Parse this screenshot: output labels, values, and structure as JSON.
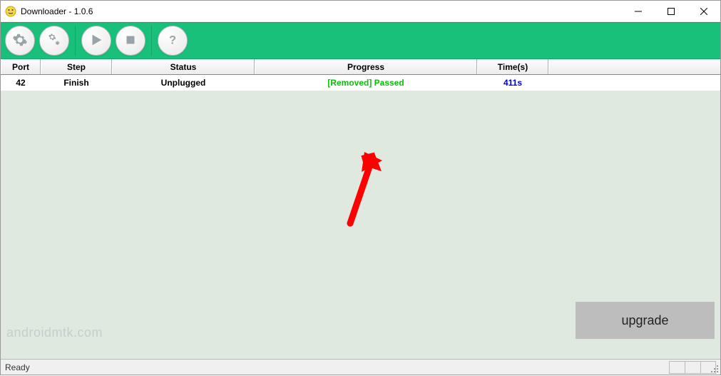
{
  "window": {
    "title": "Downloader - 1.0.6"
  },
  "toolbar": {
    "buttons": {
      "settings": "gear-icon",
      "settings2": "gears-icon",
      "start": "play-icon",
      "stop": "stop-icon",
      "help": "help-icon"
    }
  },
  "table": {
    "headers": {
      "port": "Port",
      "step": "Step",
      "status": "Status",
      "progress": "Progress",
      "time": "Time(s)"
    },
    "rows": [
      {
        "port": "42",
        "step": "Finish",
        "status": "Unplugged",
        "progress": "[Removed] Passed",
        "time": "411s"
      }
    ]
  },
  "statusbar": {
    "text": "Ready"
  },
  "upgrade": {
    "label": "upgrade"
  },
  "watermark": {
    "text": "androidmtk.com"
  }
}
